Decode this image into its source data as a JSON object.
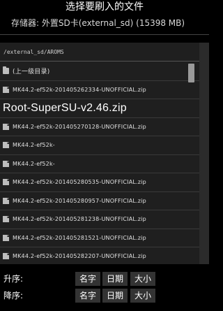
{
  "title": "选择要刷入的文件",
  "storage": "存储器: 外置SD卡(external_sd) (15398 MB)",
  "path": "/external_sd/AROMS",
  "files": [
    {
      "name": "(上一级目录)",
      "kind": "folder"
    },
    {
      "name": "MK44.2-ef52k-201405262334-UNOFFICIAL.zip",
      "kind": "file"
    },
    {
      "name": "Root-SuperSU-v2.46.zip",
      "kind": "file"
    },
    {
      "name": "MK44.2-ef52k-201405270128-UNOFFICIAL.zip",
      "kind": "file"
    },
    {
      "name": "MK44.2-ef52k-",
      "kind": "file"
    },
    {
      "name": "MK44.2-ef52k-",
      "kind": "file"
    },
    {
      "name": "MK44.2-ef52k-201405280535-UNOFFICIAL.zip",
      "kind": "file"
    },
    {
      "name": "MK44.2-ef52k-201405280957-UNOFFICIAL.zip",
      "kind": "file"
    },
    {
      "name": "MK44.2-ef52k-201405281238-UNOFFICIAL.zip",
      "kind": "file"
    },
    {
      "name": "MK44.2-ef52k-201405281521-UNOFFICIAL.zip",
      "kind": "file"
    },
    {
      "name": "MK44.2-ef52k-201405282207-UNOFFICIAL.zip",
      "kind": "file"
    }
  ],
  "sort": {
    "asc_label": "升序:",
    "desc_label": "降序:",
    "buttons": [
      "名字",
      "日期",
      "大小"
    ]
  }
}
